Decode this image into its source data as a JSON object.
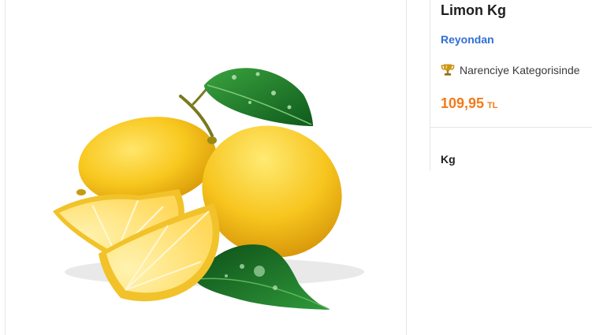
{
  "product": {
    "title": "Limon Kg",
    "brand": "Reyondan",
    "category_text": "Narenciye Kategorisinde",
    "price": "109,95",
    "currency": "TL",
    "unit": "Kg"
  },
  "image": {
    "subject": "lemons-with-leaves",
    "lemon_color": "#f7c51e",
    "leaf_color": "#1e7a2a"
  },
  "icons": {
    "category": "trophy-icon"
  },
  "colors": {
    "brand_link": "#2f6fd6",
    "price": "#f27a1a",
    "trophy": "#c9961a"
  }
}
